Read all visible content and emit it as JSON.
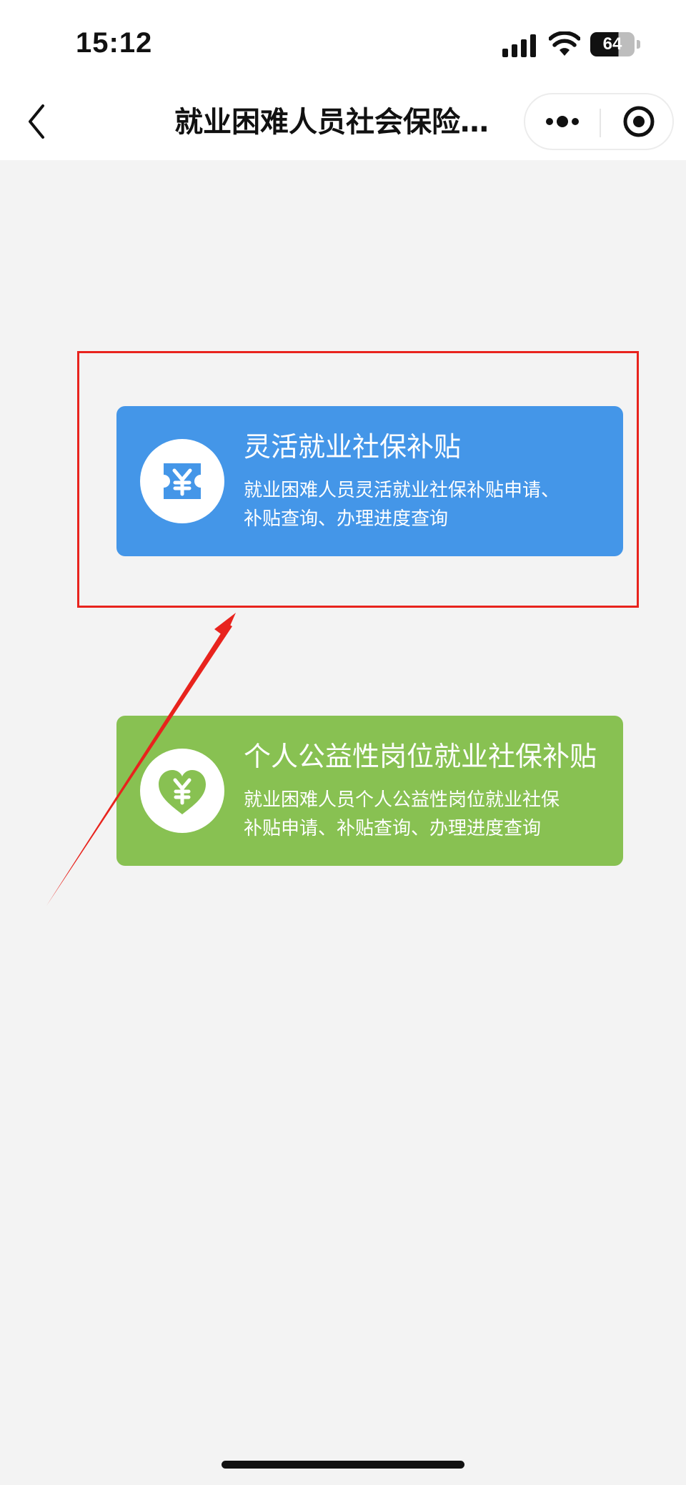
{
  "status_bar": {
    "time": "15:12",
    "battery_level": "64",
    "icons": [
      "signal-icon",
      "wifi-icon",
      "battery-icon"
    ]
  },
  "nav": {
    "title": "就业困难人员社会保险…",
    "back_icon": "chevron-left-icon",
    "more_icon": "more-dots-icon",
    "close_icon": "target-circle-icon"
  },
  "cards": [
    {
      "title": "灵活就业社保补贴",
      "desc_line1": "就业困难人员灵活就业社保补贴申请、",
      "desc_line2": "补贴查询、办理进度查询",
      "icon": "yen-ticket-icon",
      "color": "#4496e8"
    },
    {
      "title": "个人公益性岗位就业社保补贴",
      "desc_line1": "就业困难人员个人公益性岗位就业社保",
      "desc_line2": "补贴申请、补贴查询、办理进度查询",
      "icon": "yen-heart-icon",
      "color": "#88c152"
    }
  ],
  "annotation": {
    "color": "#e8231d"
  }
}
